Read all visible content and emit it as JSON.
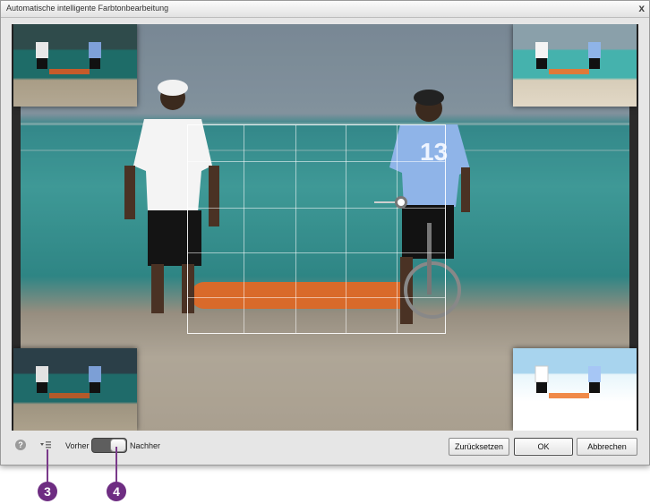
{
  "dialog": {
    "title": "Automatische intelligente Farbtonbearbeitung",
    "close_label": "x"
  },
  "footer": {
    "help_label": "?",
    "before_label": "Vorher",
    "after_label": "Nachher",
    "reset_label": "Zurücksetzen",
    "ok_label": "OK",
    "cancel_label": "Abbrechen"
  },
  "callouts": {
    "first": "3",
    "second": "4"
  },
  "photo": {
    "player_number": "13"
  },
  "colors": {
    "callout": "#6e2d82",
    "dialog_bg": "#e6e6e6",
    "sea": "#4dbbb8",
    "sand": "#d6cbb9"
  }
}
